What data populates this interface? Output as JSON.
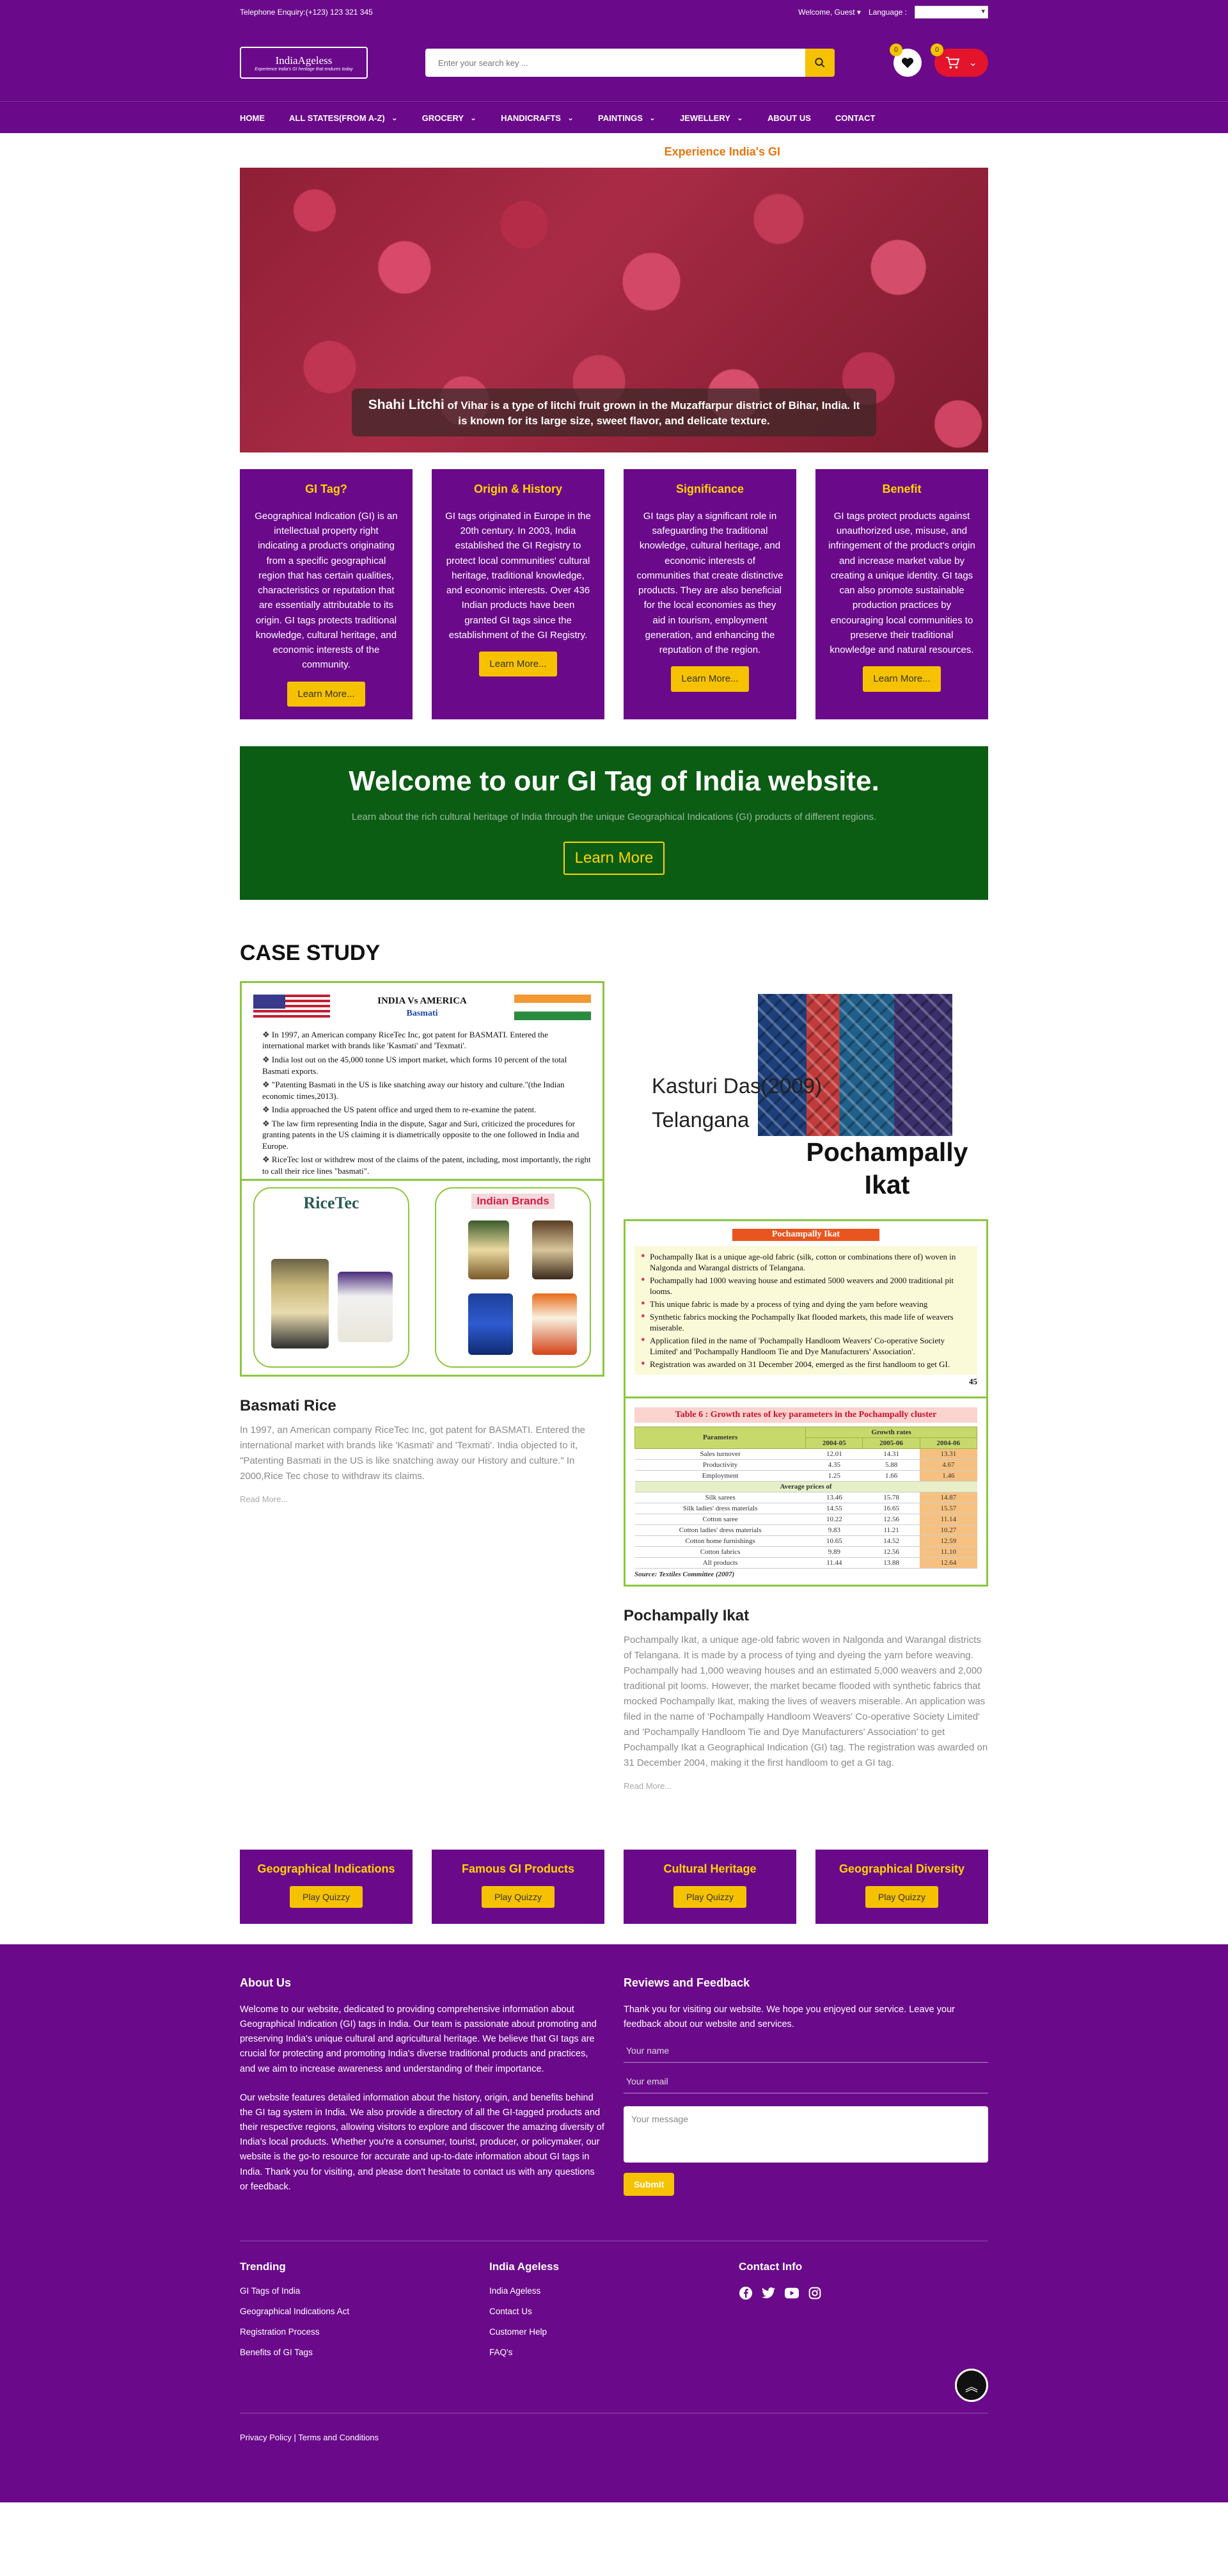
{
  "topbar": {
    "phone": "Telephone Enquiry:(+123) 123 321 345",
    "welcome": "Welcome, Guest ▾",
    "language_label": "Language :"
  },
  "logo": {
    "name": "IndiaAgeless",
    "tagline": "Experience India's GI heritage that endures today"
  },
  "search": {
    "placeholder": "Enter your search key ..."
  },
  "counts": {
    "wishlist": "0",
    "cart": "0"
  },
  "nav": [
    {
      "label": "HOME",
      "dropdown": false
    },
    {
      "label": "ALL STATES(FROM A-Z)",
      "dropdown": true
    },
    {
      "label": "GROCERY",
      "dropdown": true
    },
    {
      "label": "HANDICRAFTS",
      "dropdown": true
    },
    {
      "label": "PAINTINGS",
      "dropdown": true
    },
    {
      "label": "JEWELLERY",
      "dropdown": true
    },
    {
      "label": "ABOUT US",
      "dropdown": false
    },
    {
      "label": "CONTACT",
      "dropdown": false
    }
  ],
  "marquee": "Experience India's GI",
  "hero": {
    "caption_strong": "Shahi Litchi",
    "caption_rest": " of Vihar is a type of litchi fruit grown in the Muzaffarpur district of Bihar, India. It is known for its large size, sweet flavor, and delicate texture."
  },
  "cards": [
    {
      "title": "GI Tag?",
      "text": "Geographical Indication (GI) is an intellectual property right indicating a product's originating from a specific geographical region that has certain qualities, characteristics or reputation that are essentially attributable to its origin. GI tags protects traditional knowledge, cultural heritage, and economic interests of the community.",
      "button": "Learn More..."
    },
    {
      "title": "Origin & History",
      "text": "GI tags originated in Europe in the 20th century. In 2003, India established the GI Registry to protect local communities' cultural heritage, traditional knowledge, and economic interests. Over 436 Indian products have been granted GI tags since the establishment of the GI Registry.",
      "button": "Learn More..."
    },
    {
      "title": "Significance",
      "text": "GI tags play a significant role in safeguarding the traditional knowledge, cultural heritage, and economic interests of communities that create distinctive products. They are also beneficial for the local economies as they aid in tourism, employment generation, and enhancing the reputation of the region.",
      "button": "Learn More..."
    },
    {
      "title": "Benefit",
      "text": "GI tags protect products against unauthorized use, misuse, and infringement of the product's origin and increase market value by creating a unique identity. GI tags can also promote sustainable production practices by encouraging local communities to preserve their traditional knowledge and natural resources.",
      "button": "Learn More..."
    }
  ],
  "welcome": {
    "title": "Welcome to our GI Tag of India website.",
    "subtitle": "Learn about the rich cultural heritage of India through the unique Geographical Indications (GI) products of different regions.",
    "button": "Learn More"
  },
  "case_study": {
    "title": "CASE STUDY",
    "basmati_slide": {
      "title": "INDIA Vs AMERICA",
      "subtitle": "Basmati",
      "bullets": [
        "In 1997, an American company RiceTec Inc, got patent for BASMATI. Entered the international market with brands like 'Kasmati' and 'Texmati'.",
        "India lost out on the 45,000 tonne US import market, which forms 10 percent of the total Basmati exports.",
        "\"Patenting Basmati in the US is like snatching away our history and culture.\"(the Indian economic times,2013).",
        "India approached the US patent office and urged them to re-examine the patent.",
        "The law firm representing India in the dispute, Sagar and Suri, criticized the procedures for granting patents in the US claiming it is diametrically opposite to the one followed in India and Europe.",
        "RiceTec lost or withdrew most of the claims of the patent, including, most importantly, the right to call their rice lines \"basmati\"."
      ],
      "brand_left": "RiceTec",
      "brand_right": "Indian Brands"
    },
    "basmati": {
      "heading": "Basmati Rice",
      "text": "In 1997, an American company RiceTec Inc, got patent for BASMATI. Entered the international market with brands like 'Kasmati' and 'Texmati'. India objected to it, \"Patenting Basmati in the US is like snatching away our History and culture.\" In 2000,Rice Tec chose to withdraw its claims.",
      "read": "Read More..."
    },
    "pochampally_slide": {
      "author": "Kasturi Das(2009)",
      "state": "Telangana",
      "name": "Pochampally Ikat",
      "box_title": "Pochampally Ikat",
      "bullets": [
        "Pochampally Ikat is a unique age-old fabric (silk, cotton or combinations there of) woven in Nalgonda and Warangal districts of Telangana.",
        "Pochampally had 1000 weaving house and estimated 5000 weavers and 2000 traditional pit looms.",
        "This unique fabric is made by a process of tying and dying the yarn before weaving",
        "Synthetic fabrics mocking the Pochampally Ikat flooded markets, this made life of weavers miserable.",
        "Application filed in the name of 'Pochampally Handloom Weavers' Co-operative Society Limited' and 'Pochampally Handloom Tie and Dye Manufacturers' Association'.",
        "Registration was awarded on 31 December 2004, emerged as the first handloom to get GI."
      ],
      "page": "45",
      "table_title": "Table 6 : Growth rates of key parameters in the Pochampally cluster",
      "table_head": {
        "param": "Parameters",
        "group": "Growth rates",
        "years": [
          "2004-05",
          "2005-06",
          "2004-06"
        ]
      },
      "rows": [
        {
          "p": "Sales turnover",
          "v": [
            "12.01",
            "14.31",
            "13.31"
          ]
        },
        {
          "p": "Productivity",
          "v": [
            "4.35",
            "5.88",
            "4.67"
          ]
        },
        {
          "p": "Employment",
          "v": [
            "1.25",
            "1.66",
            "1.46"
          ]
        }
      ],
      "sub": "Average prices of",
      "rows2": [
        {
          "p": "Silk sarees",
          "v": [
            "13.46",
            "15.78",
            "14.87"
          ]
        },
        {
          "p": "Silk ladies' dress materials",
          "v": [
            "14.55",
            "16.65",
            "15.57"
          ]
        },
        {
          "p": "Cotton saree",
          "v": [
            "10.22",
            "12.56",
            "11.14"
          ]
        },
        {
          "p": "Cotton ladies' dress materials",
          "v": [
            "9.83",
            "11.21",
            "10.27"
          ]
        },
        {
          "p": "Cotton home furnishings",
          "v": [
            "10.65",
            "14.52",
            "12.59"
          ]
        },
        {
          "p": "Cotton fabrics",
          "v": [
            "9.89",
            "12.56",
            "11.10"
          ]
        },
        {
          "p": "All products",
          "v": [
            "11.44",
            "13.88",
            "12.64"
          ]
        }
      ],
      "source": "Source: Textiles Committee (2007)"
    },
    "pochampally": {
      "heading": "Pochampally Ikat",
      "text": "Pochampally Ikat, a unique age-old fabric woven in Nalgonda and Warangal districts of Telangana. It is made by a process of tying and dyeing the yarn before weaving. Pochampally had 1,000 weaving houses and an estimated 5,000 weavers and 2,000 traditional pit looms. However, the market became flooded with synthetic fabrics that mocked Pochampally Ikat, making the lives of weavers miserable. An application was filed in the name of 'Pochampally Handloom Weavers' Co-operative Society Limited' and 'Pochampally Handloom Tie and Dye Manufacturers' Association' to get Pochampally Ikat a Geographical Indication (GI) tag. The registration was awarded on 31 December 2004, making it the first handloom to get a GI tag.",
      "read": "Read More..."
    }
  },
  "quiz": [
    {
      "title": "Geographical Indications",
      "button": "Play Quizzy"
    },
    {
      "title": "Famous GI Products",
      "button": "Play Quizzy"
    },
    {
      "title": "Cultural Heritage",
      "button": "Play Quizzy"
    },
    {
      "title": "Geographical Diversity",
      "button": "Play Quizzy"
    }
  ],
  "footer": {
    "about_title": "About Us",
    "about_p1": "Welcome to our website, dedicated to providing comprehensive information about Geographical Indication (GI) tags in India. Our team is passionate about promoting and preserving India's unique cultural and agricultural heritage. We believe that GI tags are crucial for protecting and promoting India's diverse traditional products and practices, and we aim to increase awareness and understanding of their importance.",
    "about_p2": "Our website features detailed information about the history, origin, and benefits behind the GI tag system in India. We also provide a directory of all the GI-tagged products and their respective regions, allowing visitors to explore and discover the amazing diversity of India's local products. Whether you're a consumer, tourist, producer, or policymaker, our website is the go-to resource for accurate and up-to-date information about GI tags in India. Thank you for visiting, and please don't hesitate to contact us with any questions or feedback.",
    "reviews_title": "Reviews and Feedback",
    "reviews_text": "Thank you for visiting our website. We hope you enjoyed our service. Leave your feedback about our website and services.",
    "name_ph": "Your name",
    "email_ph": "Your email",
    "msg_ph": "Your message",
    "submit": "Submit",
    "trending_title": "Trending",
    "trending": [
      "GI Tags of India",
      "Geographical Indications Act",
      "Registration Process",
      "Benefits of GI Tags"
    ],
    "ageless_title": "India Ageless",
    "ageless": [
      "India Ageless",
      "Contact Us",
      "Customer Help",
      "FAQ's"
    ],
    "contact_title": "Contact Info",
    "privacy": "Privacy Policy",
    "terms": "Terms and Conditions"
  },
  "colors": {
    "primary": "#6a0a8a",
    "accent": "#f6c200",
    "title_yellow": "#ffd400",
    "welcome_green": "#0a5d13",
    "frame_green": "#8cc63f"
  }
}
